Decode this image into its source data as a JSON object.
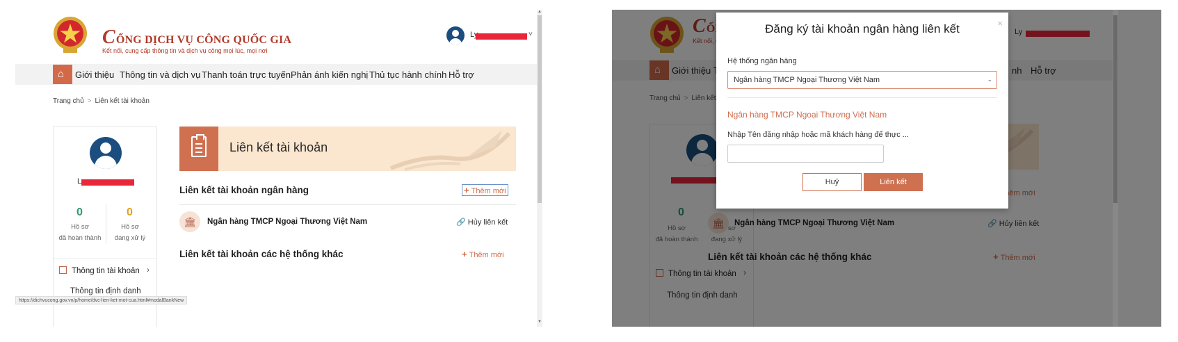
{
  "site": {
    "brand_title_initial": "C",
    "brand_title_rest": "ỔNG DỊCH VỤ CÔNG QUỐC GIA",
    "brand_title_rest_short": "ỔN",
    "brand_subtitle": "Kết nối, cung cấp thông tin và dịch vụ công mọi lúc, mọi nơi",
    "brand_subtitle_short": "Kết nối, cu",
    "user_name": "Ly",
    "dropdown_chevron": "˅"
  },
  "nav": {
    "home_icon": "home-icon",
    "items": [
      "Giới thiệu",
      "Thông tin và dịch vụ",
      "Thanh toán trực tuyến",
      "Phản ánh kiến nghị",
      "Thủ tục hành chính",
      "Hỗ trợ"
    ],
    "right_items_overlay": [
      "nh",
      "Hỗ trợ"
    ],
    "right_first_short": "T"
  },
  "breadcrumb": {
    "home": "Trang chủ",
    "separator": ">",
    "current": "Liên kết tài khoản",
    "current_short": "Liên kết tài k"
  },
  "profile": {
    "name_initial": "Ly",
    "stats": [
      {
        "value": "0",
        "label_line1": "Hồ sơ",
        "label_line2": "đã hoàn thành",
        "color": "#2e9a6a"
      },
      {
        "value": "0",
        "label_line1": "Hồ sơ",
        "label_line2": "đang xử lý",
        "color": "#e0a020"
      }
    ],
    "menu": {
      "account_info": "Thông tin tài khoản",
      "identity_info": "Thông tin định danh",
      "chevron": "›"
    }
  },
  "page": {
    "banner_title": "Liên kết tài khoản",
    "bank_section_title": "Liên kết tài khoản ngân hàng",
    "add_new": "Thêm mới",
    "add_plus": "+",
    "bank_name": "Ngân hàng TMCP Ngoại Thương Việt Nam",
    "bank_icon": "🏛",
    "unlink_label": "Hủy liên kết",
    "unlink_icon": "🔗",
    "other_section_title": "Liên kết tài khoản các hệ thống khác"
  },
  "status_bar": {
    "url": "https://dichvucong.gov.vn/p/home/dvc-lien-ket-mot-cua.html#modalBankNew"
  },
  "scrollbar": {
    "up": "▲",
    "down": "▼"
  },
  "modal": {
    "title": "Đăng ký tài khoản ngân hàng liên kết",
    "close": "×",
    "bank_system_label": "Hệ thống ngân hàng",
    "selected_bank": "Ngân hàng TMCP Ngoại Thương Việt Nam",
    "select_arrow": "⌄",
    "bank_heading": "Ngân hàng TMCP Ngoại Thương Việt Nam",
    "login_label": "Nhập Tên đăng nhập hoặc mã khách hàng để thực ...",
    "login_value": "",
    "cancel_button": "Huỷ",
    "link_button": "Liên kết"
  },
  "colors": {
    "accent": "#cf7050",
    "brand_red": "#b23a2a",
    "avatar_blue": "#1b4e7e",
    "banner_bg": "#fbe6cf",
    "redaction": "#e8273a"
  }
}
